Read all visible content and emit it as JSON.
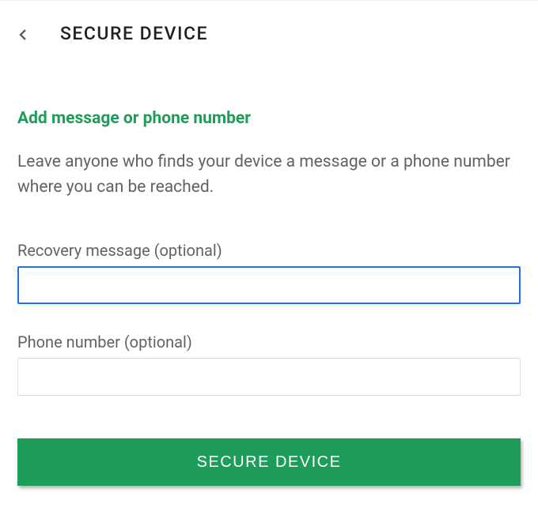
{
  "header": {
    "title": "SECURE DEVICE"
  },
  "section": {
    "title": "Add message or phone number",
    "description": "Leave anyone who finds your device a message or a phone number where you can be reached."
  },
  "fields": {
    "recovery": {
      "label": "Recovery message (optional)",
      "value": ""
    },
    "phone": {
      "label": "Phone number (optional)",
      "value": ""
    }
  },
  "actions": {
    "secure_button": "SECURE DEVICE"
  },
  "colors": {
    "accent_green": "#1e9c5a",
    "focus_blue": "#1a73e8",
    "text_secondary": "#5f6368"
  }
}
